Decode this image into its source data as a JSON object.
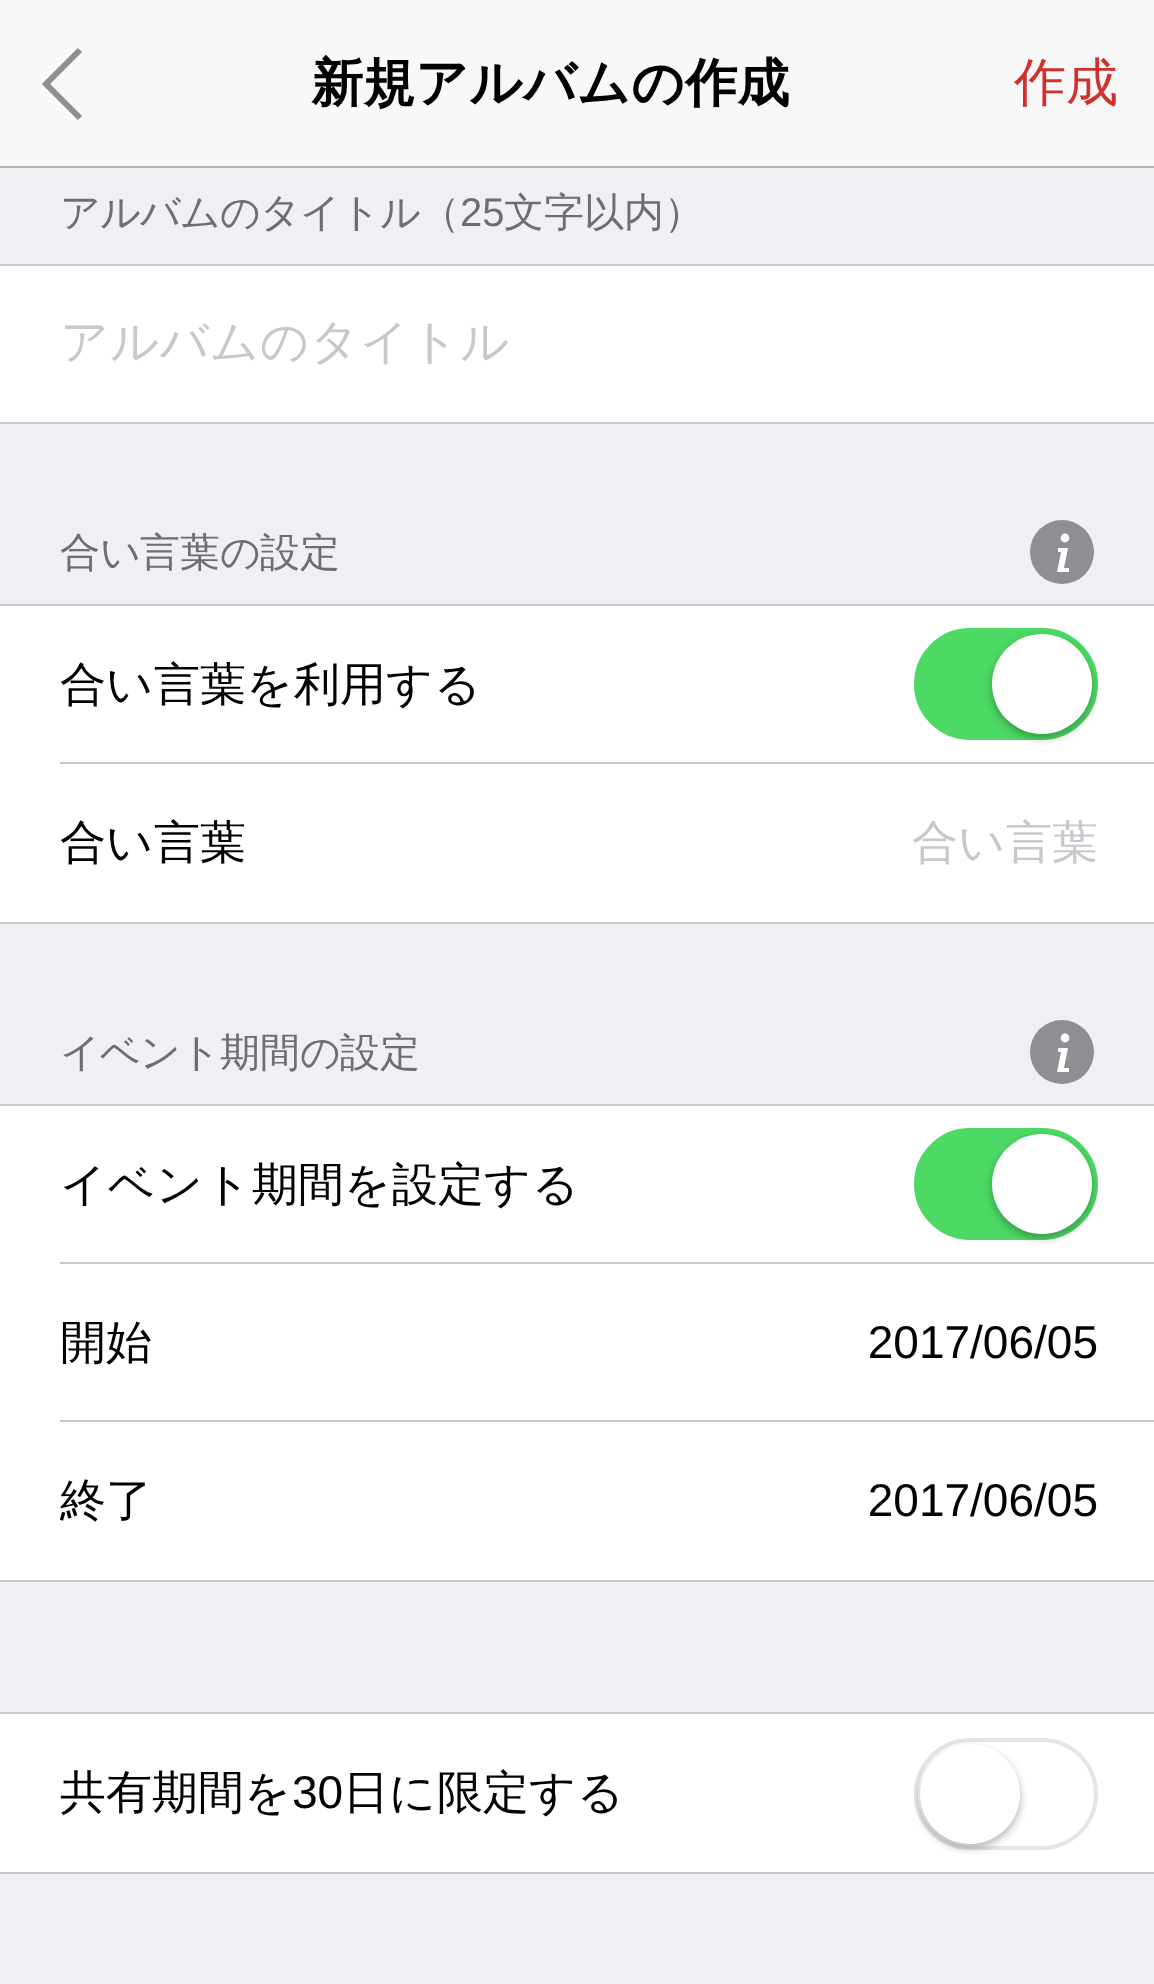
{
  "nav": {
    "title": "新規アルバムの作成",
    "action": "作成"
  },
  "sections": [
    {
      "header": "アルバムのタイトル（25文字以内）",
      "info": false,
      "rows": [
        {
          "kind": "input",
          "placeholder": "アルバムのタイトル"
        }
      ]
    },
    {
      "header": "合い言葉の設定",
      "info": true,
      "rows": [
        {
          "kind": "toggle",
          "label": "合い言葉を利用する",
          "on": true
        },
        {
          "kind": "field",
          "label": "合い言葉",
          "placeholder": "合い言葉"
        }
      ]
    },
    {
      "header": "イベント期間の設定",
      "info": true,
      "rows": [
        {
          "kind": "toggle",
          "label": "イベント期間を設定する",
          "on": true
        },
        {
          "kind": "value",
          "label": "開始",
          "value": "2017/06/05"
        },
        {
          "kind": "value",
          "label": "終了",
          "value": "2017/06/05"
        }
      ]
    },
    {
      "rows": [
        {
          "kind": "toggle",
          "label": "共有期間を30日に限定する",
          "on": false
        }
      ]
    }
  ]
}
